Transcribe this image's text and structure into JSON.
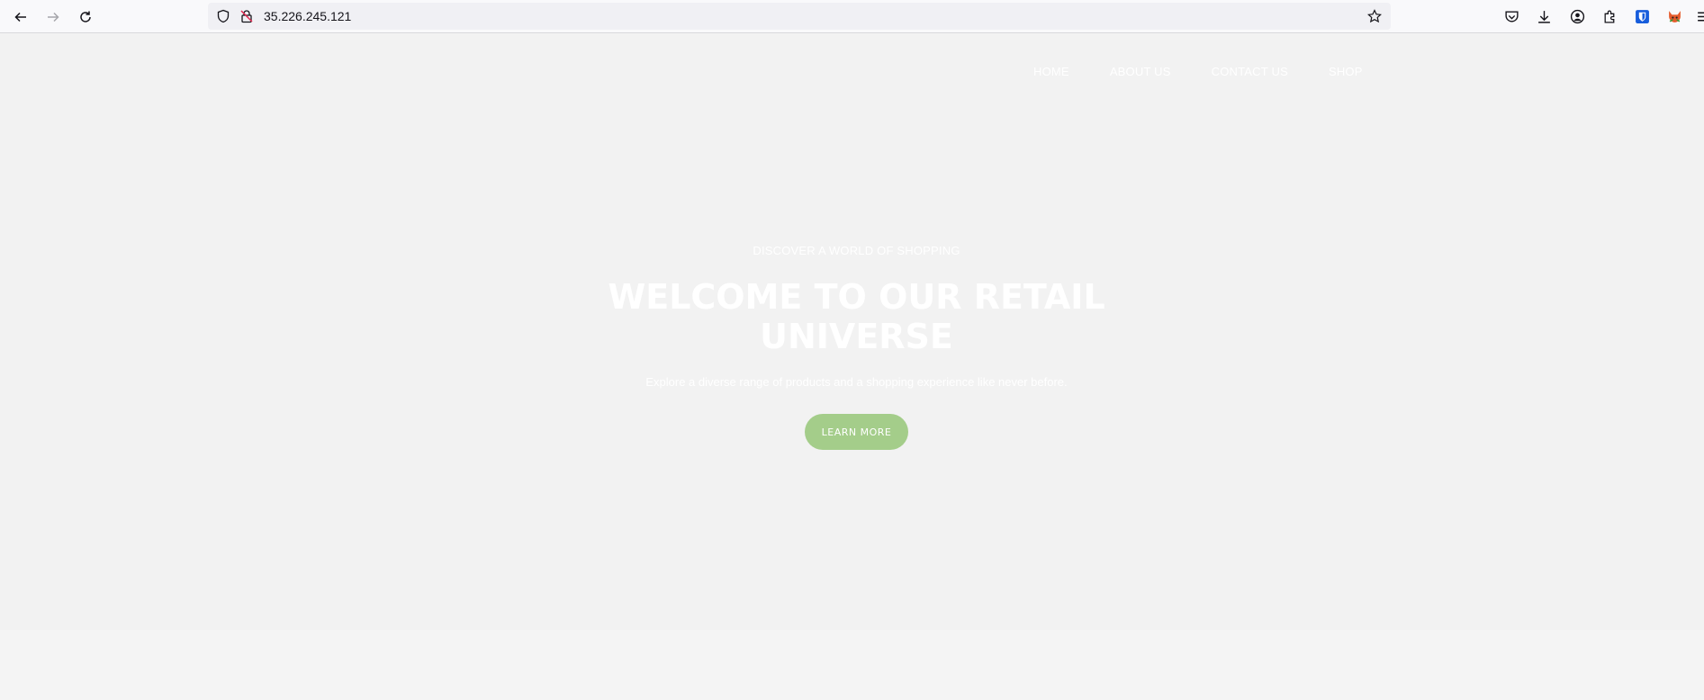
{
  "browser": {
    "url": "35.226.245.121",
    "icons": [
      "back-arrow-icon",
      "forward-arrow-icon",
      "reload-icon",
      "shield-icon",
      "insecure-lock-icon",
      "bookmark-star-icon",
      "pocket-icon",
      "download-icon",
      "account-icon",
      "extensions-icon",
      "bitwarden-icon",
      "extension-fox-icon",
      "menu-icon"
    ]
  },
  "site_nav": {
    "items": [
      {
        "label": "HOME"
      },
      {
        "label": "ABOUT US"
      },
      {
        "label": "CONTACT US"
      },
      {
        "label": "SHOP"
      }
    ]
  },
  "hero": {
    "kicker": "DISCOVER A WORLD OF SHOPPING",
    "title_line1": "WELCOME TO OUR RETAIL",
    "title_line2": "UNIVERSE",
    "description": "Explore a diverse range of products and a shopping experience like never before.",
    "cta_label": "LEARN MORE"
  },
  "colors": {
    "hero_bg": "#f2f2f2",
    "cta_bg": "#a4cd8a",
    "text_on_hero": "#ffffff"
  }
}
